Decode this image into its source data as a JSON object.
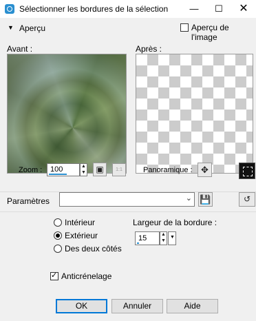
{
  "window": {
    "title": "Sélectionner les bordures de la sélection"
  },
  "preview": {
    "toggle_label": "Aperçu",
    "show_image_label": "Aperçu de l'image",
    "show_image_checked": false,
    "before_label": "Avant :",
    "after_label": "Après :",
    "zoom_label": "Zoom :",
    "zoom_value": "100",
    "pan_label": "Panoramique :"
  },
  "params": {
    "label": "Paramètres",
    "preset_value": ""
  },
  "options": {
    "mode_options": [
      {
        "label": "Intérieur",
        "selected": false
      },
      {
        "label": "Extérieur",
        "selected": true
      },
      {
        "label": "Des deux côtés",
        "selected": false
      }
    ],
    "border_width_label": "Largeur de la bordure :",
    "border_width_value": "15",
    "antialias_label": "Anticrénelage",
    "antialias_checked": true
  },
  "buttons": {
    "ok": "OK",
    "cancel": "Annuler",
    "help": "Aide"
  }
}
